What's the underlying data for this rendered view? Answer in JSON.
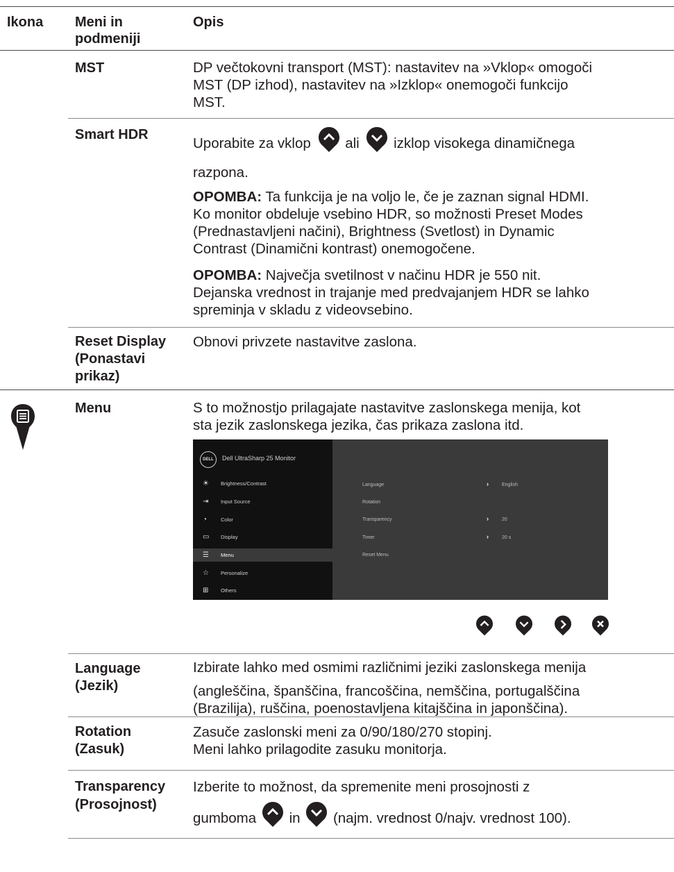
{
  "header": {
    "col1": "Ikona",
    "col2a": "Meni in",
    "col2b": "podmeniji",
    "col3": "Opis"
  },
  "rows": {
    "mst": {
      "name": "MST",
      "desc": [
        "DP večtokovni transport (MST): nastavitev na »Vklop« omogoči",
        "MST (DP izhod), nastavitev na »Izklop« onemogoči funkcijo",
        "MST."
      ]
    },
    "smart_hdr": {
      "name": "Smart HDR",
      "line1a": "Uporabite za vklop",
      "line1b": "ali",
      "line1c": "izklop visokega dinamičnega",
      "line2": "razpona.",
      "note1_label": "OPOMBA:",
      "note1": [
        " Ta funkcija je na voljo le, če je zaznan signal HDMI.",
        "Ko monitor obdeluje vsebino HDR, so možnosti Preset Modes",
        "(Prednastavljeni načini), Brightness (Svetlost) in Dynamic",
        "Contrast (Dinamični kontrast) onemogočene."
      ],
      "note2_label": "OPOMBA:",
      "note2": [
        " Največja svetilnost v načinu HDR je 550 nit.",
        "Dejanska vrednost in trajanje med predvajanjem HDR se lahko",
        "spreminja v skladu z videovsebino."
      ]
    },
    "reset": {
      "name": [
        "Reset Display",
        "(Ponastavi",
        "prikaz)"
      ],
      "desc": "Obnovi privzete nastavitve zaslona."
    },
    "menu": {
      "name": "Menu",
      "desc": [
        "S to možnostjo prilagajate nastavitve zaslonskega menija, kot",
        "sta jezik zaslonskega jezika, čas prikaza zaslona itd."
      ]
    },
    "language": {
      "name": [
        "Language",
        "(Jezik)"
      ],
      "desc": [
        "Izbirate lahko med osmimi različnimi jeziki zaslonskega menija",
        "(angleščina, španščina, francoščina, nemščina, portugalščina",
        "(Brazilija), ruščina, poenostavljena kitajščina in japonščina)."
      ]
    },
    "rotation": {
      "name": [
        "Rotation",
        "(Zasuk)"
      ],
      "desc": [
        "Zasuče zaslonski meni za 0/90/180/270 stopinj.",
        "Meni lahko prilagodite zasuku monitorja."
      ]
    },
    "transparency": {
      "name": [
        "Transparency",
        "(Prosojnost)"
      ],
      "desc1": "Izberite to možnost, da spremenite meni prosojnosti z",
      "desc2a": "gumboma",
      "desc2b": "in",
      "desc2c": "(najm. vrednost 0/najv. vrednost 100)."
    }
  },
  "osd": {
    "logo": "DELL",
    "title": "Dell UltraSharp 25 Monitor",
    "items": [
      {
        "icon": "brightness-icon",
        "glyph": "☀",
        "label": "Brightness/Contrast"
      },
      {
        "icon": "input-source-icon",
        "glyph": "⇥",
        "label": "Input Source"
      },
      {
        "icon": "color-icon",
        "glyph": "◔",
        "label": "Color"
      },
      {
        "icon": "display-icon",
        "glyph": "▭",
        "label": "Display"
      },
      {
        "icon": "menu-icon",
        "glyph": "☰",
        "label": "Menu"
      },
      {
        "icon": "personalize-icon",
        "glyph": "☆",
        "label": "Personalize"
      },
      {
        "icon": "others-icon",
        "glyph": "⊞",
        "label": "Others"
      }
    ],
    "submenu": [
      {
        "label": "Language",
        "arrow": "›",
        "value": "English"
      },
      {
        "label": "Rotation",
        "arrow": "",
        "value": ""
      },
      {
        "label": "Transparency",
        "arrow": "›",
        "value": "20"
      },
      {
        "label": "Timer",
        "arrow": "›",
        "value": "20 s"
      },
      {
        "label": "Reset Menu",
        "arrow": "",
        "value": ""
      }
    ],
    "selected_index": 4
  },
  "colors": {
    "accent_dark": "#231f20",
    "osd_bg": "#111111",
    "osd_panel": "#3a3a3a",
    "osd_selected": "#3a3a3a"
  }
}
